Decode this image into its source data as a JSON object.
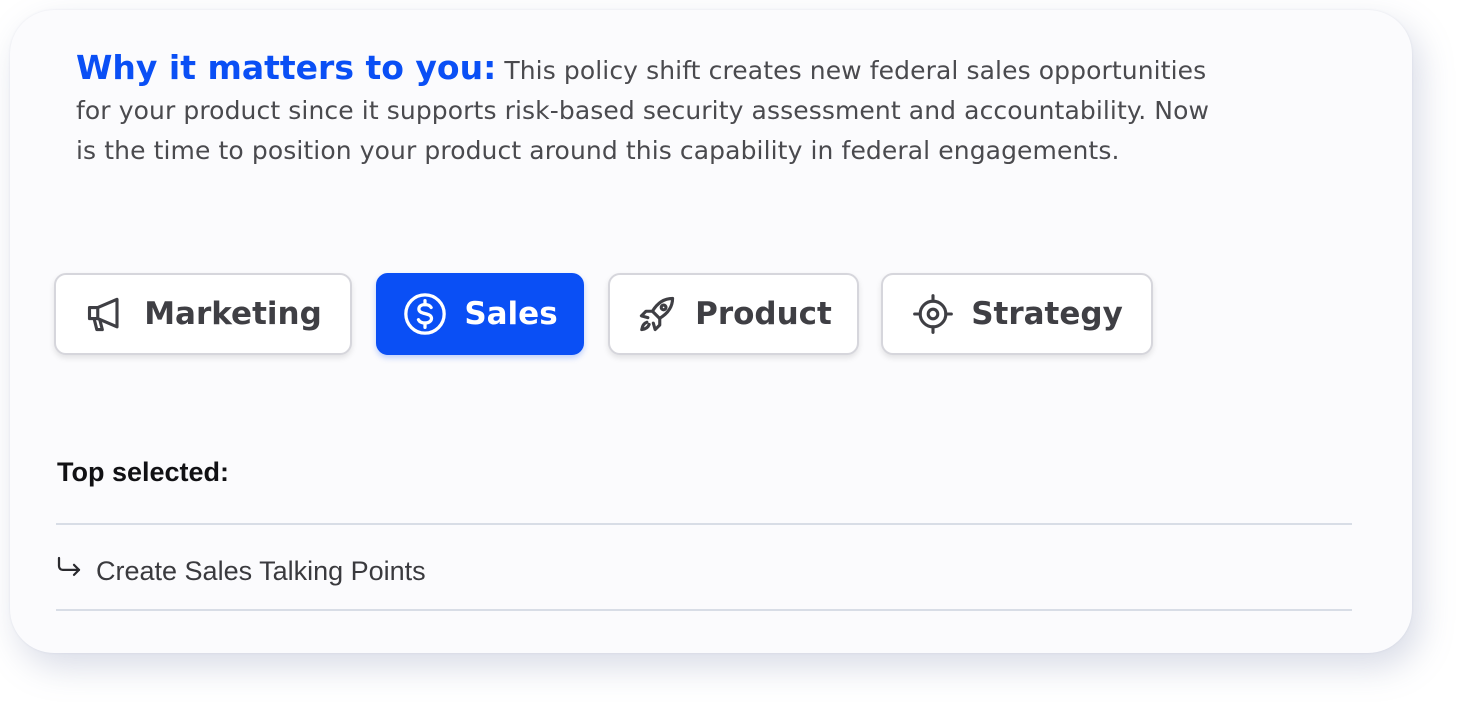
{
  "insight": {
    "lead": "Why it matters to you:",
    "body": "This policy shift creates new federal sales opportunities for your product since it supports risk-based security assessment and accountability. Now is the time to position your product around this capability in federal engagements."
  },
  "chips": [
    {
      "label": "Marketing",
      "icon": "megaphone-icon",
      "selected": false
    },
    {
      "label": "Sales",
      "icon": "dollar-circle-icon",
      "selected": true
    },
    {
      "label": "Product",
      "icon": "rocket-icon",
      "selected": false
    },
    {
      "label": "Strategy",
      "icon": "target-icon",
      "selected": false
    }
  ],
  "top_selected": {
    "label": "Top selected:",
    "items": [
      {
        "label": "Create Sales Talking Points",
        "icon": "arrow-turn-down-right-icon"
      }
    ]
  },
  "colors": {
    "accent": "#0a4ff5",
    "text": "#4a4a4e",
    "divider": "#d8dde6"
  }
}
